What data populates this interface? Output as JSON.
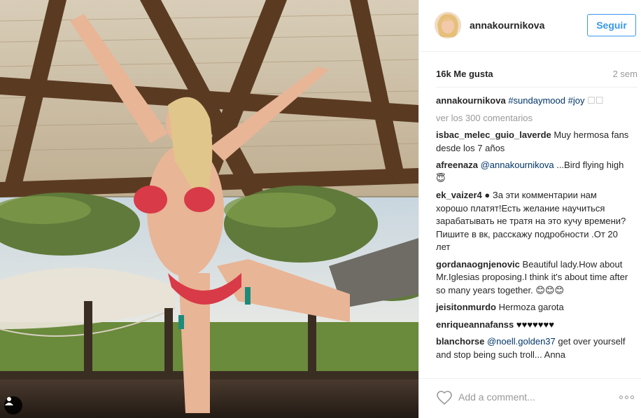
{
  "post": {
    "username": "annakournikova",
    "follow_label": "Seguir",
    "likes": "16k Me gusta",
    "time": "2 sem",
    "caption_user": "annakournikova",
    "caption_tags": "#sundaymood #joy",
    "caption_emoji": "☐☐",
    "view_all": "ver los 300 comentarios"
  },
  "comments": [
    {
      "user": "isbac_melec_guio_laverde",
      "mention": "",
      "text": " Muy hermosa fans desde los 7 años"
    },
    {
      "user": "afreenaza",
      "mention": "@annakournikova",
      "text": " ...Bird flying high😇"
    },
    {
      "user": "ek_vaizer4",
      "mention": "",
      "text": " ● За эти комментарии нам хорошо платят!Есть желание научиться зарабатывать не тратя на это кучу времени?Пишите в вк, расскажу подробности .От 20 лет"
    },
    {
      "user": "gordanaognjenovic",
      "mention": "",
      "text": " Beautiful lady.How about Mr.Iglesias proposing.I think it's about time after so many years together. 😊😊😊"
    },
    {
      "user": "jeisitonmurdo",
      "mention": "",
      "text": " Hermoza garota"
    },
    {
      "user": "enriqueannafanss",
      "mention": "",
      "text": " ♥♥♥♥♥♥♥"
    },
    {
      "user": "blanchorse",
      "mention": "@noell.golden37",
      "text": " get over yourself and stop being such troll... Anna"
    }
  ],
  "comment_box": {
    "placeholder": "Add a comment..."
  },
  "icons": {
    "heart": "heart-icon",
    "more": "more-options-icon",
    "tag": "user-tag-icon"
  },
  "colors": {
    "accent": "#3897f0",
    "link": "#003569",
    "muted": "#999999"
  }
}
